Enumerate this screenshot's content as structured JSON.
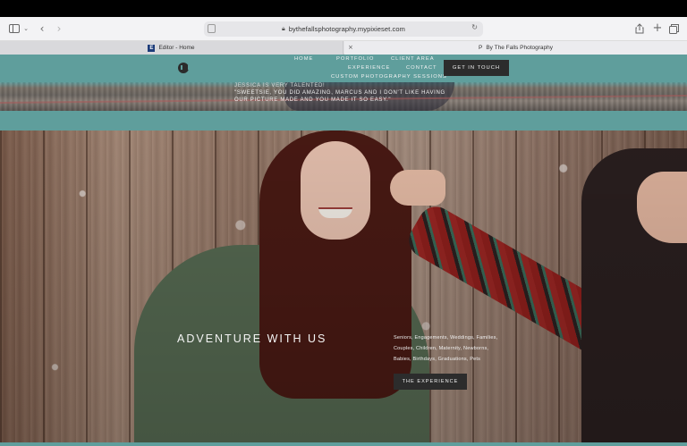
{
  "browser": {
    "address": {
      "url": "bythefallsphotography.mypixieset.com"
    },
    "icons": {
      "sidebar": "sidebar-icon",
      "back": "back-icon",
      "forward": "forward-icon",
      "share": "share-icon",
      "new_tab": "plus-icon",
      "tabs_overview": "tabs-icon",
      "lock": "lock-icon",
      "reload": "reload-icon"
    },
    "tabs": [
      {
        "title": "Editor - Home",
        "favicon": "E"
      },
      {
        "title": "By The Falls Photography",
        "favicon": "P"
      }
    ]
  },
  "site": {
    "nav": {
      "home": "HOME",
      "portfolio": "PORTFOLIO",
      "client_area": "CLIENT AREA",
      "experience": "EXPERIENCE",
      "contact": "CONTACT",
      "custom_sessions": "CUSTOM PHOTOGRAPHY SESSIONS",
      "cta": "GET IN TOUCH"
    },
    "testimonial": {
      "line1": "JESSICA IS VERY TALENTED!",
      "line2": "\"SWEETSIE, YOU DID AMAZING, MARCUS AND I DON'T LIKE HAVING",
      "line3": "OUR PICTURE MADE AND YOU MADE IT SO EASY.\""
    },
    "hero": {
      "title": "ADVENTURE WITH US",
      "desc_line1": "Seniors, Engagements, Weddings, Families,",
      "desc_line2": "Couples, Children, Maternity, Newborns,",
      "desc_line3": "Babies, Birthdays, Graduations, Pets",
      "button": "THE EXPERIENCE"
    },
    "colors": {
      "accent": "#5f9e9c",
      "button": "#2c2c2c"
    }
  }
}
